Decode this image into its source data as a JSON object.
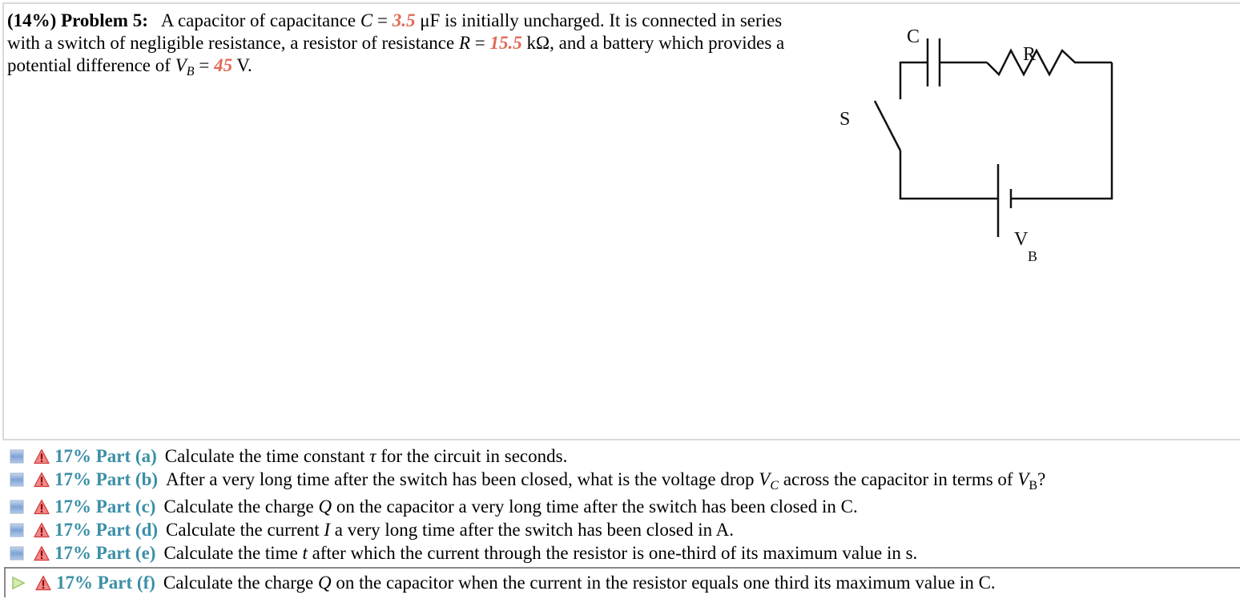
{
  "problem": {
    "weight": "(14%)",
    "title": "Problem 5:",
    "text_1": "A capacitor of capacitance ",
    "cap_var": "C",
    "eq": " = ",
    "cap_value": "3.5",
    "text_2": " μF is initially uncharged. It is connected in series with a switch of negligible resistance, a resistor of resistance ",
    "res_var": "R",
    "res_value": "15.5",
    "text_3": " kΩ, and a battery which provides a potential difference of ",
    "volt_var": "V",
    "volt_sub": "B",
    "volt_value": "45",
    "text_4": " V.",
    "value_color": "#e06a55"
  },
  "circuit": {
    "label_capacitor": "C",
    "label_resistor": "R",
    "label_switch": "S",
    "label_battery": "V",
    "label_battery_sub": "B"
  },
  "parts": [
    {
      "label": "17% Part (a)",
      "status_icon": "collapsed-box-icon",
      "pre": "Calculate the time constant ",
      "var": "τ",
      "sub": "",
      "post": " for the circuit in seconds.",
      "extra_var": "",
      "extra_sub": "",
      "tail": ""
    },
    {
      "label": "17% Part (b)",
      "status_icon": "collapsed-box-icon",
      "pre": "After a very long time after the switch has been closed, what is the voltage drop ",
      "var": "V",
      "sub": "C",
      "post": " across the capacitor in terms of ",
      "extra_var": "V",
      "extra_sub": "B",
      "tail": "?"
    },
    {
      "label": "17% Part (c)",
      "status_icon": "collapsed-box-icon",
      "pre": "Calculate the charge ",
      "var": "Q",
      "sub": "",
      "post": " on the capacitor a very long time after the switch has been closed in C.",
      "extra_var": "",
      "extra_sub": "",
      "tail": ""
    },
    {
      "label": "17% Part (d)",
      "status_icon": "collapsed-box-icon",
      "pre": "Calculate the current ",
      "var": "I",
      "sub": "",
      "post": " a very long time after the switch has been closed in A.",
      "extra_var": "",
      "extra_sub": "",
      "tail": ""
    },
    {
      "label": "17% Part (e)",
      "status_icon": "collapsed-box-icon",
      "pre": "Calculate the time ",
      "var": "t",
      "sub": "",
      "post": " after which the current through the resistor is one-third of its maximum value in s.",
      "extra_var": "",
      "extra_sub": "",
      "tail": ""
    },
    {
      "label": "17% Part (f)",
      "status_icon": "play-arrow-icon",
      "pre": "Calculate the charge ",
      "var": "Q",
      "sub": "",
      "post": " on the capacitor when the current in the resistor equals one third its maximum value in C.",
      "extra_var": "",
      "extra_sub": "",
      "tail": ""
    }
  ],
  "colors": {
    "part_label": "#3a8fa6",
    "warning": "#e04848",
    "box_icon": "#6f95c8",
    "play_icon": "#a9cf7a"
  }
}
